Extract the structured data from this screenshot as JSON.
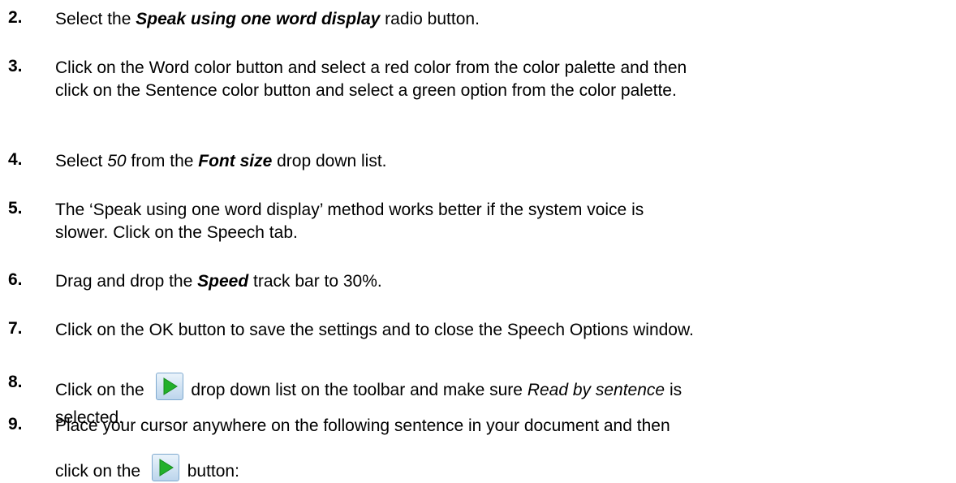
{
  "steps": [
    {
      "number": "2.",
      "lines": [
        [
          {
            "t": "Select the "
          },
          {
            "t": "Speak using one word display",
            "s": "bi"
          },
          {
            "t": " radio button."
          }
        ]
      ]
    },
    {
      "number": "3.",
      "lines": [
        [
          {
            "t": "Click on the "
          },
          {
            "t": "Word color",
            "s": "b"
          },
          {
            "t": " button and select a red color from the color palette and then"
          }
        ],
        [
          {
            "t": "click on the "
          },
          {
            "t": "Sentence color",
            "s": "b"
          },
          {
            "t": " button and select a green option from the color palette."
          }
        ]
      ]
    },
    {
      "number": "4.",
      "lines": [
        [
          {
            "t": "Select "
          },
          {
            "t": "50",
            "s": "i"
          },
          {
            "t": " from the "
          },
          {
            "t": "Font size",
            "s": "bi"
          },
          {
            "t": " drop down list."
          }
        ]
      ]
    },
    {
      "number": "5.",
      "lines": [
        [
          {
            "t": "The ‘Speak using one word display’ method works better if the system voice is"
          }
        ],
        [
          {
            "t": "slower. Click on the Speech tab."
          }
        ]
      ]
    },
    {
      "number": "6.",
      "lines": [
        [
          {
            "t": "Drag and drop the "
          },
          {
            "t": "Speed",
            "s": "bi"
          },
          {
            "t": " track bar to 30%."
          }
        ]
      ]
    },
    {
      "number": "7.",
      "lines": [
        [
          {
            "t": "Click on the "
          },
          {
            "t": "OK",
            "s": "b"
          },
          {
            "t": " button to save the settings and to close the Speech Options window."
          }
        ]
      ]
    },
    {
      "number": "8.",
      "lines": [
        [
          {
            "t": "Click on the "
          },
          {
            "icon": "play-icon"
          },
          {
            "t": " drop down list on the toolbar and make sure "
          },
          {
            "t": "Read by sentence",
            "s": "i"
          },
          {
            "t": " is"
          }
        ],
        [
          {
            "t": "selected."
          }
        ]
      ]
    },
    {
      "number": "9.",
      "lines": [
        [
          {
            "t": "Place your cursor anywhere on the following sentence in your document and then"
          }
        ],
        [
          {
            "t": "click on the "
          },
          {
            "icon": "play-icon"
          },
          {
            "t": " button:"
          }
        ]
      ]
    }
  ],
  "colors": {
    "icon_arrow": "#22b02a",
    "icon_bg_top": "#eaf3fb",
    "icon_bg_bottom": "#bcd5ec"
  }
}
